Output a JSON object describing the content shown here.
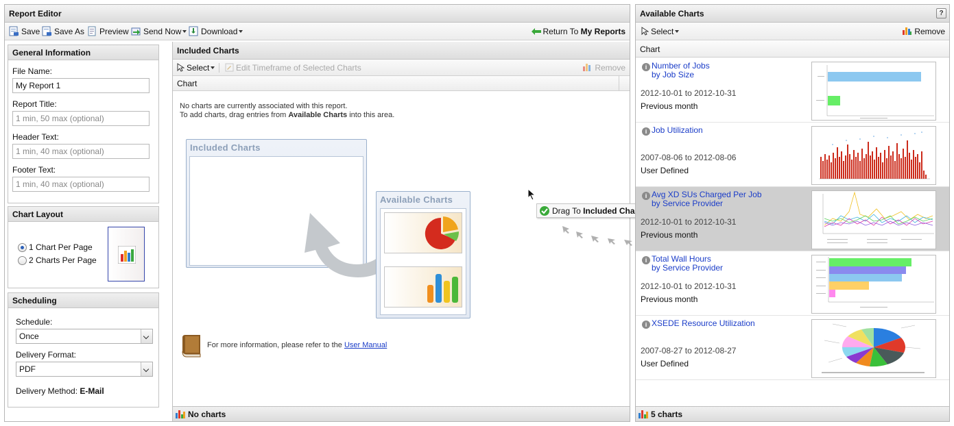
{
  "report_editor": {
    "title": "Report Editor",
    "toolbar": {
      "save": "Save",
      "save_as": "Save As",
      "preview": "Preview",
      "send_now": "Send Now",
      "download": "Download",
      "return_prefix": "Return To",
      "return_target": "My Reports"
    }
  },
  "general_info": {
    "title": "General Information",
    "file_name_label": "File Name:",
    "file_name_value": "My Report 1",
    "report_title_label": "Report Title:",
    "report_title_placeholder": "1 min, 50 max (optional)",
    "header_text_label": "Header Text:",
    "header_text_placeholder": "1 min, 40 max (optional)",
    "footer_text_label": "Footer Text:",
    "footer_text_placeholder": "1 min, 40 max (optional)"
  },
  "chart_layout": {
    "title": "Chart Layout",
    "option1": "1 Chart Per Page",
    "option2": "2 Charts Per Page",
    "selected": 1
  },
  "scheduling": {
    "title": "Scheduling",
    "schedule_label": "Schedule:",
    "schedule_value": "Once",
    "delivery_format_label": "Delivery Format:",
    "delivery_format_value": "PDF",
    "delivery_method_label": "Delivery Method:",
    "delivery_method_value": "E-Mail"
  },
  "included_charts": {
    "title": "Included Charts",
    "select_label": "Select",
    "edit_timeframe_label": "Edit Timeframe of Selected Charts",
    "remove_label": "Remove",
    "column_header": "Chart",
    "empty_line1": "No charts are currently associated with this report.",
    "empty_line2_prefix": "To add charts, drag entries from",
    "empty_line2_bold": "Available Charts",
    "empty_line2_suffix": "into this area.",
    "illustration_included": "Included Charts",
    "illustration_available": "Available Charts",
    "more_info_prefix": "For more information, please refer to the",
    "more_info_link": "User Manual",
    "footer": "No charts"
  },
  "drag_tooltip": {
    "prefix": "Drag To",
    "target": "Included Charts"
  },
  "available_charts": {
    "title": "Available Charts",
    "help": "?",
    "select_label": "Select",
    "remove_label": "Remove",
    "column_header": "Chart",
    "footer": "5 charts",
    "items": [
      {
        "title": "Number of Jobs",
        "subtitle": "by Job Size",
        "dates_from": "2012-10-01",
        "dates_to": "2012-10-31",
        "period": "Previous month"
      },
      {
        "title": "Job Utilization",
        "subtitle": "",
        "dates_from": "2007-08-06",
        "dates_to": "2012-08-06",
        "period": "User Defined"
      },
      {
        "title": "Avg XD SUs Charged Per Job",
        "subtitle": "by Service Provider",
        "dates_from": "2012-10-01",
        "dates_to": "2012-10-31",
        "period": "Previous month"
      },
      {
        "title": "Total Wall Hours",
        "subtitle": "by Service Provider",
        "dates_from": "2012-10-01",
        "dates_to": "2012-10-31",
        "period": "Previous month"
      },
      {
        "title": "XSEDE Resource Utilization",
        "subtitle": "",
        "dates_from": "2007-08-27",
        "dates_to": "2012-08-27",
        "period": "User Defined"
      }
    ],
    "date_sep": "to"
  },
  "colors": {
    "link": "#1a3cc8",
    "selected_row": "#cfcfcf",
    "bar_blue": "#8cc8f0",
    "bar_green": "#66ee66",
    "bar_red": "#cc2a1a"
  }
}
